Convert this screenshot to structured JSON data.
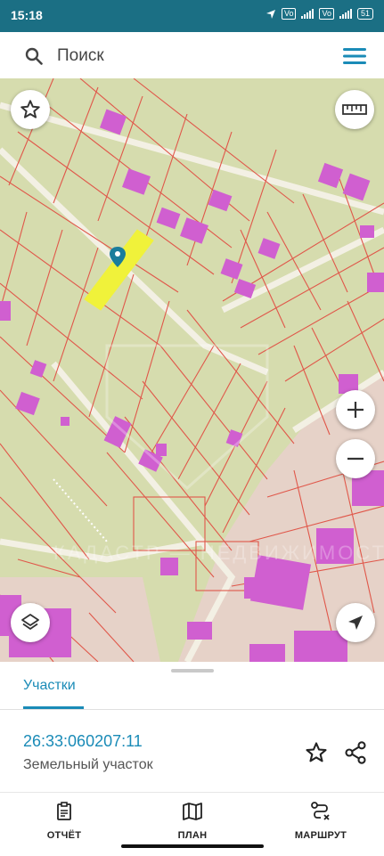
{
  "status_bar": {
    "time": "15:18",
    "icons": [
      "location-arrow-icon",
      "volte-icon",
      "signal-icon",
      "volte-4g-icon",
      "signal-icon",
      "battery-icon"
    ],
    "volte_label": "Vo",
    "battery": "51"
  },
  "search": {
    "placeholder": "Поиск",
    "icon": "search-icon",
    "menu_icon": "menu-icon"
  },
  "map": {
    "controls": [
      "favorite-star-icon",
      "ruler-icon",
      "zoom-in-icon",
      "zoom-out-icon",
      "layers-icon",
      "locate-icon"
    ],
    "watermark": "КАДАСТР — НЕДВИЖИМОСТЬ",
    "colors": {
      "parcel_fill": "#d6dcae",
      "parcel_border": "#e0574a",
      "building": "#d05fd0",
      "selected": "#f0f23a",
      "pin": "#1a7d9c",
      "road": "#f4f2e8"
    }
  },
  "sheet": {
    "tab_label": "Участки",
    "parcel_number": "26:33:060207:11",
    "parcel_type": "Земельный участок",
    "actions": [
      "star-icon",
      "share-icon"
    ]
  },
  "bottom_nav": {
    "items": [
      {
        "label": "ОТЧЁТ",
        "icon": "report-icon"
      },
      {
        "label": "ПЛАН",
        "icon": "map-plan-icon"
      },
      {
        "label": "МАРШРУТ",
        "icon": "route-icon"
      }
    ]
  },
  "accent_color": "#1a8bb7"
}
